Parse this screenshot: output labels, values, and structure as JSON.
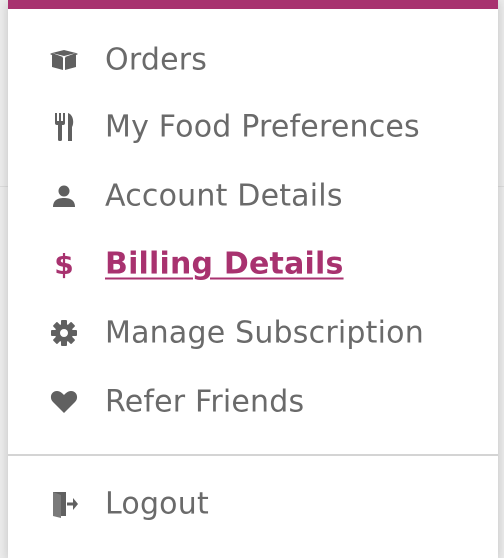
{
  "colors": {
    "accent": "#a8326f",
    "text": "#6a6a6a",
    "icon": "#606060"
  },
  "menu": {
    "items": [
      {
        "label": "Orders",
        "icon": "box-icon",
        "active": false
      },
      {
        "label": "My Food Preferences",
        "icon": "fork-knife-icon",
        "active": false
      },
      {
        "label": "Account Details",
        "icon": "user-icon",
        "active": false
      },
      {
        "label": "Billing Details",
        "icon": "dollar-icon",
        "active": true
      },
      {
        "label": "Manage Subscription",
        "icon": "gear-icon",
        "active": false
      },
      {
        "label": "Refer Friends",
        "icon": "heart-icon",
        "active": false
      }
    ],
    "logout": {
      "label": "Logout",
      "icon": "logout-icon"
    }
  }
}
